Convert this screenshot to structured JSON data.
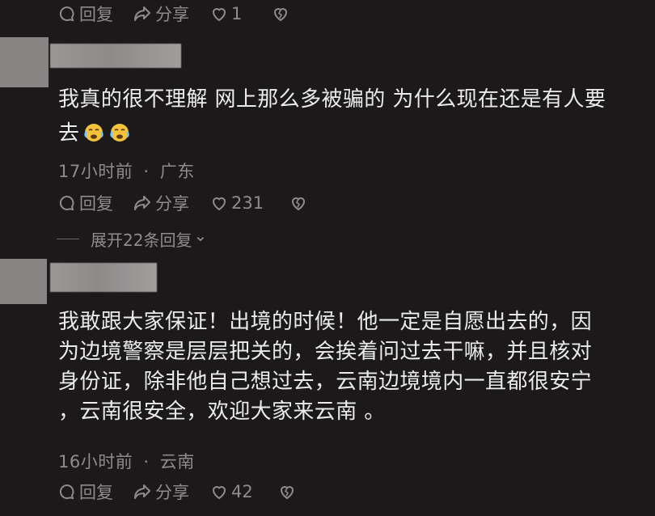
{
  "prev_comment": {
    "actions": {
      "reply": "回复",
      "share": "分享",
      "likes": "1"
    }
  },
  "comment1": {
    "text_line1": "我真的很不理解 网上那么多被骗的 为什么现在还是有人要",
    "text_line2": "去",
    "time": "17小时前",
    "location": "广东",
    "meta_sep": "·",
    "actions": {
      "reply": "回复",
      "share": "分享",
      "likes": "231"
    },
    "expand_label": "展开22条回复",
    "expand_chevron": "⌄"
  },
  "comment2": {
    "text_lines": [
      "我敢跟大家保证！出境的时候！他一定是自愿出去的，因",
      "为边境警察是层层把关的，会挨着问过去干嘛，并且核对",
      "身份证，除非他自己想过去，云南边境境内一直都很安宁",
      "，云南很安全，欢迎大家来云南 。"
    ],
    "time": "16小时前",
    "location": "云南",
    "meta_sep": "·",
    "actions": {
      "reply": "回复",
      "share": "分享",
      "likes": "42"
    }
  },
  "icons": {
    "reply": "reply-bubble-icon",
    "share": "share-arrow-icon",
    "like": "heart-icon",
    "dislike": "broken-heart-icon",
    "emoji": "crying-face-emoji"
  },
  "colors": {
    "background": "#1b1919",
    "text": "#ecebeb",
    "muted": "#8f8b8b",
    "avatar_placeholder": "#878584"
  }
}
